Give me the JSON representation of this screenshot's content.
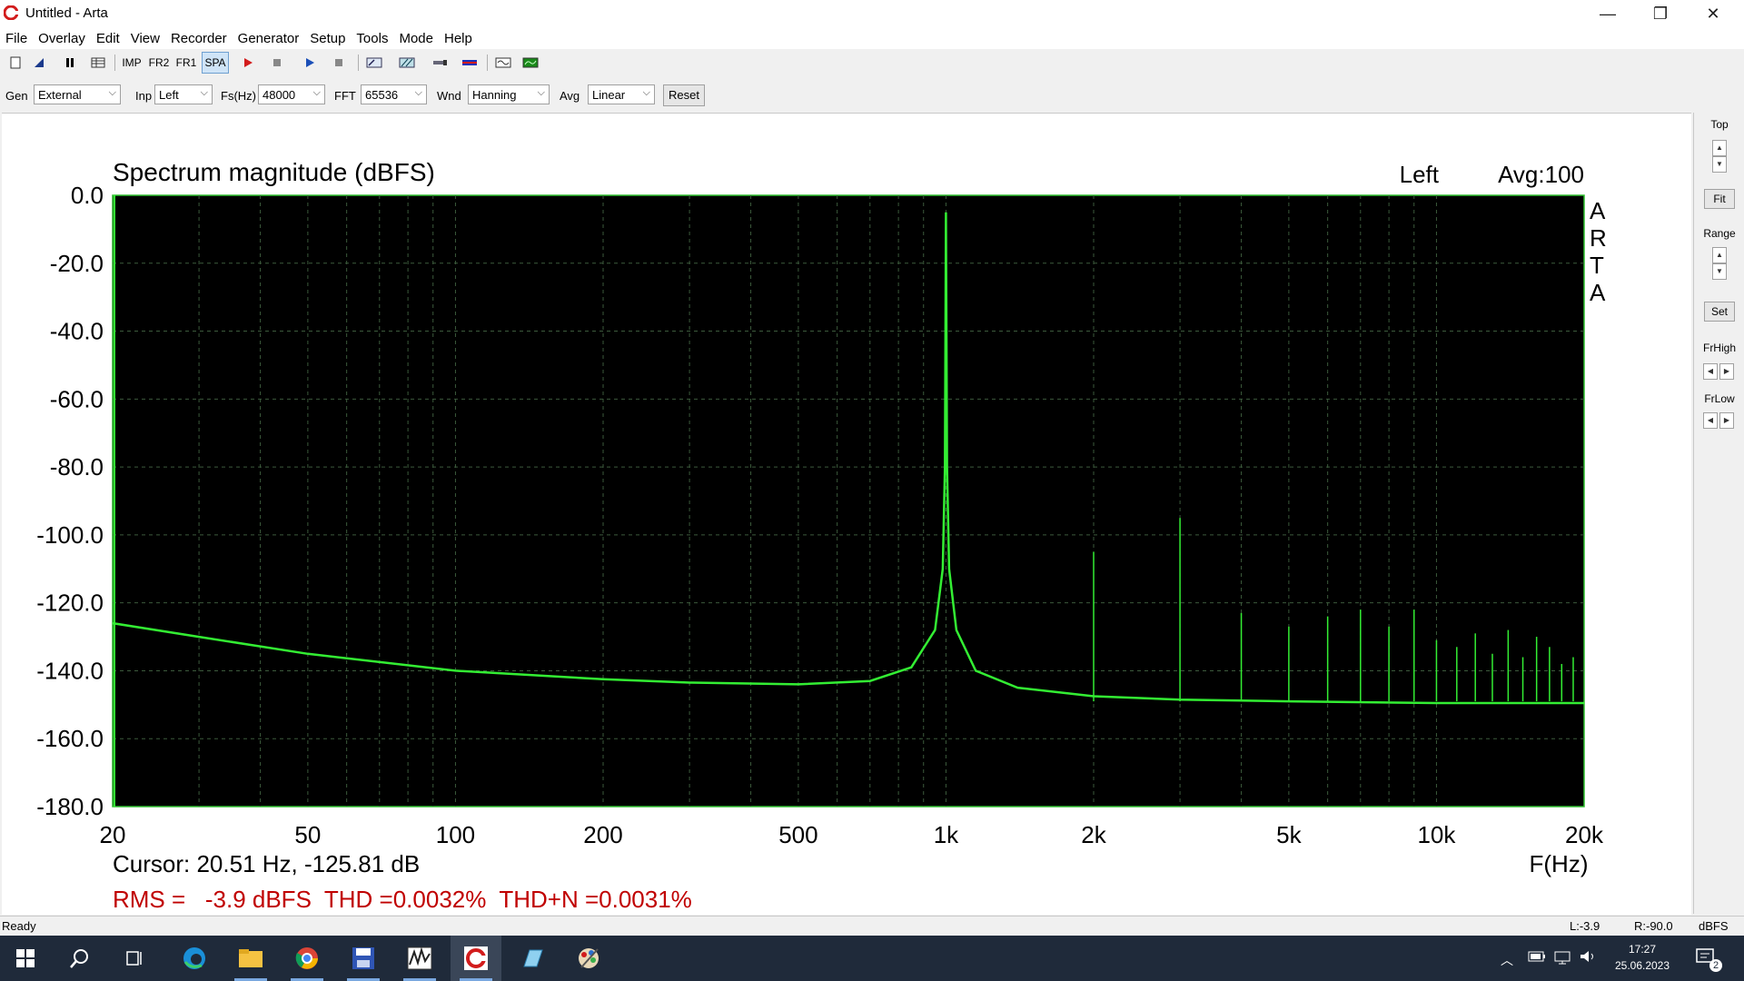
{
  "window": {
    "title": "Untitled - Arta"
  },
  "menu": [
    "File",
    "Overlay",
    "Edit",
    "View",
    "Recorder",
    "Generator",
    "Setup",
    "Tools",
    "Mode",
    "Help"
  ],
  "toolbar": {
    "imp": "IMP",
    "fr2": "FR2",
    "fr1": "FR1",
    "spa": "SPA"
  },
  "controls": {
    "gen_label": "Gen",
    "gen_value": "External",
    "inp_label": "Inp",
    "inp_value": "Left",
    "fs_label": "Fs(Hz)",
    "fs_value": "48000",
    "fft_label": "FFT",
    "fft_value": "65536",
    "wnd_label": "Wnd",
    "wnd_value": "Hanning",
    "avg_label": "Avg",
    "avg_value": "Linear",
    "reset_label": "Reset"
  },
  "right_panel": {
    "top": "Top",
    "fit": "Fit",
    "range": "Range",
    "set": "Set",
    "frhigh": "FrHigh",
    "frlow": "FrLow"
  },
  "plot": {
    "cursor": "Cursor: 20.51 Hz, -125.81 dB",
    "measurement": "RMS =   -3.9 dBFS  THD =0.0032%  THD+N =0.0031%",
    "logo": [
      "A",
      "R",
      "T",
      "A"
    ]
  },
  "chart_data": {
    "type": "line",
    "title": "Spectrum magnitude (dBFS)",
    "channel_label": "Left",
    "avg_label": "Avg:100",
    "xlabel": "F(Hz)",
    "x_scale": "log",
    "xlim": [
      20,
      20000
    ],
    "ylim": [
      -180,
      0
    ],
    "y_ticks": [
      "0.0",
      "-20.0",
      "-40.0",
      "-60.0",
      "-80.0",
      "-100.0",
      "-120.0",
      "-140.0",
      "-160.0",
      "-180.0"
    ],
    "x_ticks": [
      {
        "v": 20,
        "label": "20"
      },
      {
        "v": 50,
        "label": "50"
      },
      {
        "v": 100,
        "label": "100"
      },
      {
        "v": 200,
        "label": "200"
      },
      {
        "v": 500,
        "label": "500"
      },
      {
        "v": 1000,
        "label": "1k"
      },
      {
        "v": 2000,
        "label": "2k"
      },
      {
        "v": 5000,
        "label": "5k"
      },
      {
        "v": 10000,
        "label": "10k"
      },
      {
        "v": 20000,
        "label": "20k"
      }
    ],
    "grid": true,
    "colors": {
      "background": "#000000",
      "trace": "#33ee33",
      "grid": "#3c5a3c",
      "frame": "#2fbf2f",
      "measurement": "#c00000"
    },
    "series": [
      {
        "noise_floor": [
          [
            20,
            -126
          ],
          [
            30,
            -130
          ],
          [
            50,
            -135
          ],
          [
            100,
            -140
          ],
          [
            200,
            -142.5
          ],
          [
            300,
            -143.5
          ],
          [
            500,
            -144
          ],
          [
            700,
            -143
          ],
          [
            850,
            -139
          ],
          [
            950,
            -128
          ],
          [
            985,
            -110
          ],
          [
            995,
            -80
          ],
          [
            1000,
            -5
          ],
          [
            1005,
            -80
          ],
          [
            1015,
            -110
          ],
          [
            1050,
            -128
          ],
          [
            1150,
            -140
          ],
          [
            1400,
            -145
          ],
          [
            2000,
            -147.5
          ],
          [
            3000,
            -148.5
          ],
          [
            5000,
            -149
          ],
          [
            10000,
            -149.5
          ],
          [
            20000,
            -149.5
          ]
        ],
        "harmonics": [
          [
            2000,
            -105
          ],
          [
            3000,
            -95
          ],
          [
            4000,
            -123
          ],
          [
            5000,
            -127
          ],
          [
            6000,
            -124
          ],
          [
            7000,
            -122
          ],
          [
            8000,
            -127
          ],
          [
            9000,
            -122
          ],
          [
            10000,
            -131
          ],
          [
            11000,
            -133
          ],
          [
            12000,
            -129
          ],
          [
            13000,
            -135
          ],
          [
            14000,
            -128
          ],
          [
            15000,
            -136
          ],
          [
            16000,
            -130
          ],
          [
            17000,
            -133
          ],
          [
            18000,
            -138
          ],
          [
            19000,
            -136
          ]
        ]
      }
    ]
  },
  "status": {
    "ready": "Ready",
    "l": "L:-3.9",
    "r": "R:-90.0",
    "unit": "dBFS"
  },
  "taskbar": {
    "time": "17:27",
    "date": "25.06.2023",
    "notif_count": "2"
  }
}
